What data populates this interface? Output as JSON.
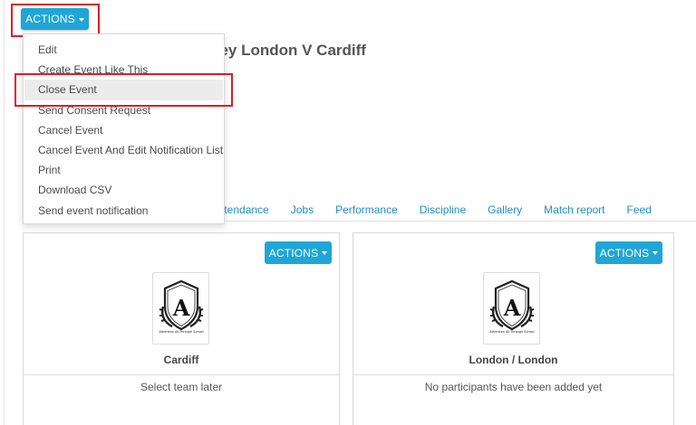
{
  "top_actions": {
    "label": "ACTIONS"
  },
  "event": {
    "title_visible": "key London V Cardiff"
  },
  "dropdown": {
    "items": [
      {
        "label": "Edit"
      },
      {
        "label": "Create Event Like This"
      },
      {
        "label": "Close Event",
        "active": true
      },
      {
        "label": "Send Consent Request"
      },
      {
        "label": "Cancel Event"
      },
      {
        "label": "Cancel Event And Edit Notification List"
      },
      {
        "label": "Print"
      },
      {
        "label": "Download CSV"
      },
      {
        "label": "Send event notification"
      }
    ]
  },
  "tabs": [
    {
      "label": "Attendance"
    },
    {
      "label": "Jobs"
    },
    {
      "label": "Performance"
    },
    {
      "label": "Discipline"
    },
    {
      "label": "Gallery"
    },
    {
      "label": "Match report"
    },
    {
      "label": "Feed"
    }
  ],
  "teams": [
    {
      "actions_label": "ACTIONS",
      "name": "Cardiff",
      "note": "Select team later",
      "crest_text": "Atherstan All-Through School",
      "crest_letter": "A"
    },
    {
      "actions_label": "ACTIONS",
      "name": "London / London",
      "note": "No participants have been added yet",
      "crest_text": "Atherstan All-Through School",
      "crest_letter": "A"
    }
  ],
  "colors": {
    "accent": "#1fa6d6",
    "link": "#1e8fc6",
    "highlight": "#e31b23"
  }
}
